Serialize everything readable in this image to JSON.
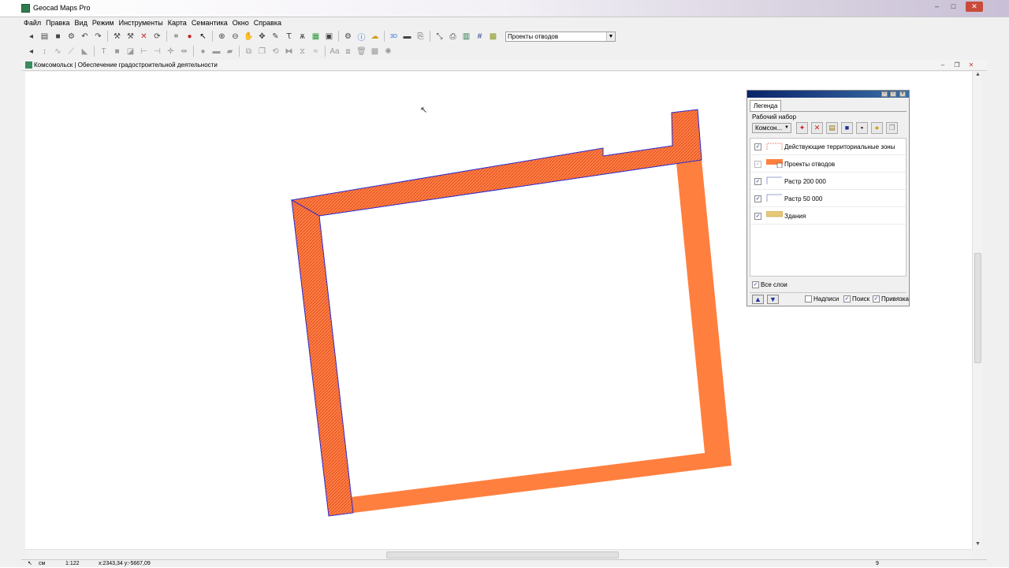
{
  "window": {
    "title": "Geocad Maps Pro"
  },
  "menu": [
    "Файл",
    "Правка",
    "Вид",
    "Режим",
    "Инструменты",
    "Карта",
    "Семантика",
    "Окно",
    "Справка"
  ],
  "toolbar": {
    "layer_select_value": "Проекты отводов",
    "label_3d": "3D"
  },
  "document": {
    "title": "Комсомольск | Обеспечение градостроительной деятельности"
  },
  "legend": {
    "tab": "Легенда",
    "set_label": "Рабочий набор",
    "set_value": "Комсон...",
    "layers": [
      {
        "name": "Действующие территориальные зоны",
        "checked": true,
        "enabled": true
      },
      {
        "name": "Проекты отводов",
        "checked": true,
        "enabled": false
      },
      {
        "name": "Растр 200 000",
        "checked": true,
        "enabled": true
      },
      {
        "name": "Растр 50 000",
        "checked": true,
        "enabled": true
      },
      {
        "name": "Здания",
        "checked": true,
        "enabled": true
      }
    ],
    "all_layers": "Все слои",
    "options": {
      "labels": "Надписи",
      "search": "Поиск",
      "snap": "Привязка"
    },
    "check_mark": "✓"
  },
  "status": {
    "mode": "см",
    "scale": "1:122",
    "coords": "x:2343,34 y:-5667,09",
    "page": "9"
  },
  "colors": {
    "parcel_fill": "#ff7f3f",
    "parcel_edge": "#2a2ad0",
    "hatch": "#e0502a"
  },
  "icons": {
    "row1": [
      "arrow-left-icon",
      "open-folder-icon",
      "save-icon",
      "properties-icon",
      "undo-icon",
      "redo-icon",
      "tools-icon",
      "tools2-icon",
      "delete-icon",
      "refresh-icon",
      "select-frame-icon",
      "record-icon",
      "pointer-icon",
      "zoom-in-icon",
      "zoom-out-icon",
      "pan-icon",
      "center-icon",
      "pen-icon",
      "layers-icon",
      "binoculars-icon",
      "color-layers-icon",
      "frame-icon",
      "settings-icon",
      "info-icon",
      "cloud-icon",
      "3d-icon",
      "image-icon",
      "export-icon",
      "measure-icon",
      "print-icon",
      "calc-icon",
      "grid-icon",
      "raster-icon"
    ],
    "row2": [
      "arrow-left-icon",
      "vertical-line-icon",
      "curve-icon",
      "polyline-icon",
      "fill-icon",
      "text-icon",
      "square-icon",
      "snap-icon",
      "align-icon",
      "distribute-icon",
      "move-icon",
      "resize-icon",
      "circle-icon",
      "rect-icon",
      "parallelogram-icon",
      "mirror-icon",
      "copy-icon",
      "rotate-icon",
      "merge-icon",
      "split-icon",
      "smooth-icon",
      "font-icon",
      "group-icon",
      "trash-icon",
      "stamp-icon",
      "gear-icon"
    ]
  }
}
